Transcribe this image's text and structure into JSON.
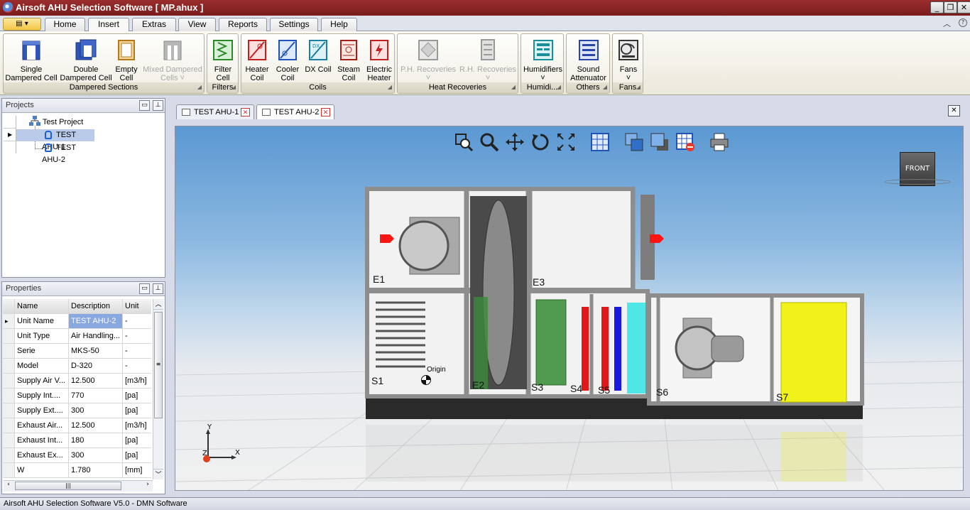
{
  "window": {
    "title": "Airsoft AHU Selection Software [ MP.ahux ]",
    "controls": [
      "_",
      "❐",
      "✕"
    ]
  },
  "ribbon_tabs": [
    {
      "label": "Home"
    },
    {
      "label": "Insert"
    },
    {
      "label": "Extras"
    },
    {
      "label": "View"
    },
    {
      "label": "Reports"
    },
    {
      "label": "Settings"
    },
    {
      "label": "Help"
    }
  ],
  "active_tab": "Insert",
  "ribbon": {
    "dampered": {
      "title": "Dampered Sections",
      "single_l1": "Single",
      "single_l2": "Dampered Cell",
      "double_l1": "Double",
      "double_l2": "Dampered Cell",
      "empty_l1": "Empty",
      "empty_l2": "Cell",
      "mixed_l1": "Mixed Dampered",
      "mixed_l2": "Cells"
    },
    "filters": {
      "title": "Filters",
      "filter_l1": "Filter",
      "filter_l2": "Cell"
    },
    "coils": {
      "title": "Coils",
      "heater_l1": "Heater",
      "heater_l2": "Coil",
      "cooler_l1": "Cooler",
      "cooler_l2": "Coil",
      "dx": "DX Coil",
      "steam_l1": "Steam",
      "steam_l2": "Coil",
      "electric_l1": "Electric",
      "electric_l2": "Heater"
    },
    "heat_recoveries": {
      "title": "Heat Recoveries",
      "ph": "P.H. Recoveries",
      "rh": "R.H. Recoveries"
    },
    "humidifiers": {
      "title": "Humidi...",
      "label": "Humidifiers"
    },
    "others": {
      "title": "Others",
      "sound_l1": "Sound",
      "sound_l2": "Attenuator"
    },
    "fans": {
      "title": "Fans",
      "label": "Fans"
    }
  },
  "projects_panel": {
    "title": "Projects",
    "project": "Test Project",
    "items": [
      {
        "label": "TEST AHU-1"
      },
      {
        "label": "TEST AHU-2"
      }
    ]
  },
  "properties_panel": {
    "title": "Properties",
    "headers": {
      "name": "Name",
      "desc": "Description",
      "unit": "Unit"
    },
    "rows": [
      {
        "name": "Unit Name",
        "desc": "TEST AHU-2",
        "unit": "-"
      },
      {
        "name": "Unit Type",
        "desc": "Air Handling...",
        "unit": "-"
      },
      {
        "name": "Serie",
        "desc": "MKS-50",
        "unit": "-"
      },
      {
        "name": "Model",
        "desc": "D-320",
        "unit": "-"
      },
      {
        "name": "Supply Air V...",
        "desc": "12.500",
        "unit": "[m3/h]"
      },
      {
        "name": "Supply Int....",
        "desc": "770",
        "unit": "[pa]"
      },
      {
        "name": "Supply Ext....",
        "desc": "300",
        "unit": "[pa]"
      },
      {
        "name": "Exhaust Air...",
        "desc": "12.500",
        "unit": "[m3/h]"
      },
      {
        "name": "Exhaust Int...",
        "desc": "180",
        "unit": "[pa]"
      },
      {
        "name": "Exhaust Ex...",
        "desc": "300",
        "unit": "[pa]"
      },
      {
        "name": "W",
        "desc": "1.780",
        "unit": "[mm]"
      }
    ]
  },
  "doc_tabs": [
    {
      "label": "TEST AHU-1"
    },
    {
      "label": "TEST AHU-2"
    }
  ],
  "viewport": {
    "cube_label": "FRONT",
    "origin_label": "Origin",
    "axis_x": "X",
    "axis_y": "Y",
    "axis_z": "Z",
    "section_labels": [
      "E1",
      "E3",
      "S1",
      "E2",
      "S3",
      "S4",
      "S5",
      "S6",
      "S7"
    ]
  },
  "status": "Airsoft AHU Selection Software V5.0  - DMN Software"
}
